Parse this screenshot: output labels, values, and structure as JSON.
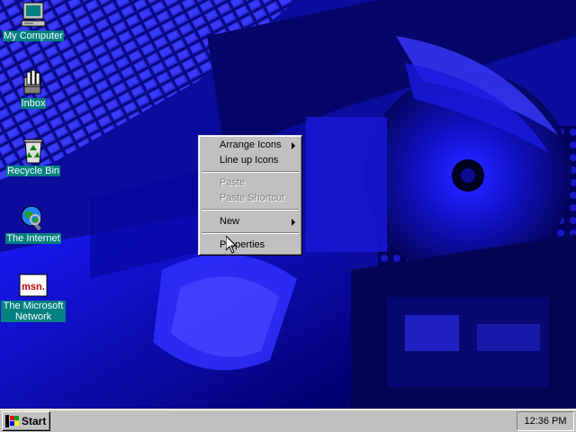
{
  "desktop": {
    "background_color": "#0a0a9a",
    "icons": [
      {
        "label": "My Computer",
        "icon": "computer-icon"
      },
      {
        "label": "Inbox",
        "icon": "inbox-icon"
      },
      {
        "label": "Recycle Bin",
        "icon": "recycle-bin-icon"
      },
      {
        "label": "The Internet",
        "icon": "internet-globe-icon"
      },
      {
        "label": "The Microsoft Network",
        "icon": "msn-icon"
      }
    ]
  },
  "context_menu": {
    "items": [
      {
        "label": "Arrange Icons",
        "enabled": true,
        "submenu": true
      },
      {
        "label": "Line up Icons",
        "enabled": true,
        "submenu": false
      },
      {
        "label": "Paste",
        "enabled": false,
        "submenu": false
      },
      {
        "label": "Paste Shortcut",
        "enabled": false,
        "submenu": false
      },
      {
        "label": "New",
        "enabled": true,
        "submenu": true
      },
      {
        "label": "Properties",
        "enabled": true,
        "submenu": false
      }
    ]
  },
  "taskbar": {
    "start_label": "Start",
    "clock": "12:36 PM",
    "color": "#c0c0c0"
  },
  "msn_logo_text": "msn."
}
